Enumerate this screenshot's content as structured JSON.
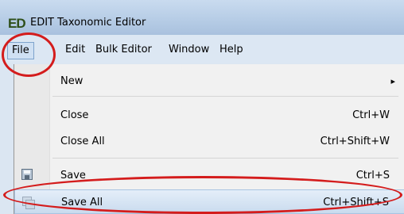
{
  "window": {
    "logo_letters": "ED",
    "title": "EDIT Taxonomic Editor"
  },
  "menubar": {
    "items": [
      "File",
      "Edit",
      "Bulk Editor",
      "Window",
      "Help"
    ]
  },
  "file_menu": {
    "new": {
      "label": "New",
      "submenu_arrow": "▸"
    },
    "close": {
      "label": "Close",
      "shortcut": "Ctrl+W"
    },
    "close_all": {
      "label": "Close All",
      "shortcut": "Ctrl+Shift+W"
    },
    "save": {
      "label": "Save",
      "shortcut": "Ctrl+S",
      "icon": "save-disk-icon"
    },
    "save_all": {
      "label": "Save All",
      "shortcut": "Ctrl+Shift+S",
      "icon": "save-all-disks-icon"
    }
  },
  "annotations": {
    "highlight_color": "#d41c1c"
  }
}
